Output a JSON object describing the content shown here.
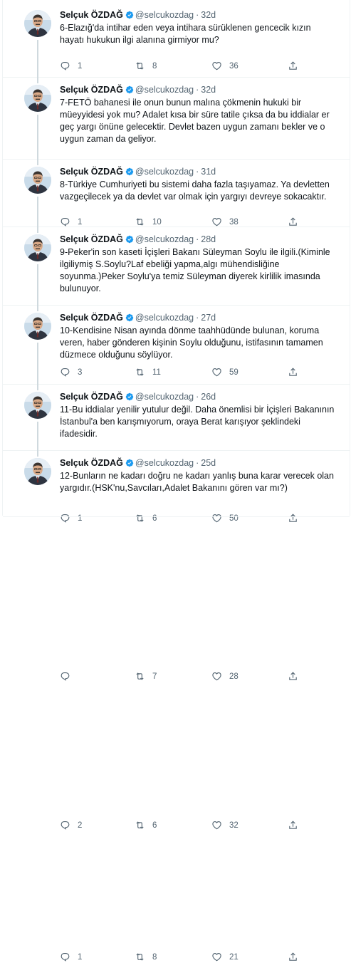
{
  "author": {
    "name": "Selçuk ÖZDAĞ",
    "handle": "@selcukozdag",
    "separator": "·"
  },
  "colors": {
    "text": "#0f1419",
    "secondary": "#536471",
    "verified": "#1d9bf0",
    "divider": "#eff3f4",
    "thread_line": "#cfd9de"
  },
  "icons": [
    "verified-badge-icon",
    "reply-icon",
    "retweet-icon",
    "like-icon",
    "share-icon"
  ],
  "tweets": [
    {
      "time": "32d",
      "text": "6-Elazığ'da intihar eden veya intihara sürüklenen gencecik kızın hayatı hukukun ilgi alanına girmiyor mu?",
      "replies": "1",
      "retweets": "8",
      "likes": "36"
    },
    {
      "time": "32d",
      "text": "7-FETÖ bahanesi ile onun bunun malına çökmenin hukuki bir müeyyidesi yok mu? Adalet kısa bir süre tatile çıksa da bu iddialar er geç yargı önüne gelecektir. Devlet bazen uygun zamanı bekler ve o uygun zaman da geliyor.",
      "replies": "1",
      "retweets": "10",
      "likes": "38"
    },
    {
      "time": "31d",
      "text": "8-Türkiye Cumhuriyeti bu sistemi daha fazla taşıyamaz. Ya devletten vazgeçilecek ya da devlet var olmak için yargıyı devreye sokacaktır.",
      "replies": "3",
      "retweets": "11",
      "likes": "59"
    },
    {
      "time": "28d",
      "text": "9-Peker'in son kaseti İçişleri Bakanı Süleyman Soylu ile ilgili.(Kiminle ilgiliymiş S.Soylu?Laf ebeliği yapma,algı mühendisliğine soyunma.)Peker Soylu'ya temiz Süleyman diyerek kirlilik imasında bulunuyor.",
      "replies": "1",
      "retweets": "6",
      "likes": "50"
    },
    {
      "time": "27d",
      "text": "10-Kendisine Nisan ayında dönme taahhüdünde bulunan, koruma veren, haber gönderen kişinin Soylu olduğunu, istifasının tamamen düzmece olduğunu söylüyor.",
      "replies": "",
      "retweets": "7",
      "likes": "28"
    },
    {
      "time": "26d",
      "text": "11-Bu iddialar yenilir yutulur değil. Daha önemlisi bir İçişleri Bakanının İstanbul'a ben karışmıyorum, oraya Berat karışıyor şeklindeki ifadesidir.",
      "replies": "2",
      "retweets": "6",
      "likes": "32"
    },
    {
      "time": "25d",
      "text": "12-Bunların ne kadarı doğru ne kadarı yanlış buna karar verecek olan yargıdır.(HSK'nu,Savcıları,Adalet Bakanını gören var mı?)",
      "replies": "1",
      "retweets": "8",
      "likes": "21"
    }
  ]
}
